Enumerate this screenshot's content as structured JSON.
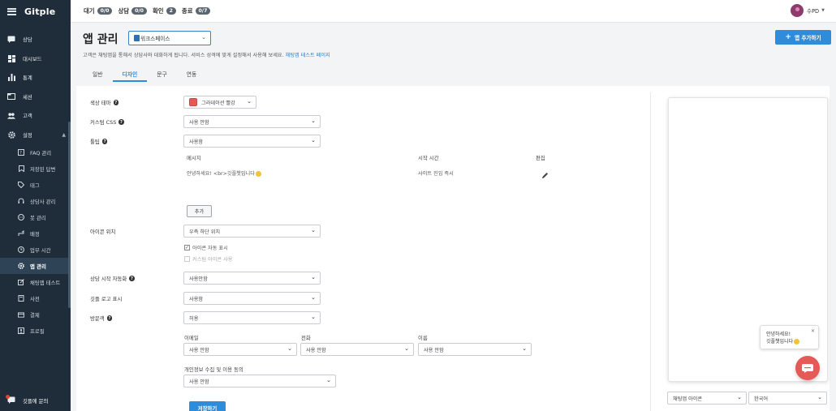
{
  "brand": "Gitple",
  "stats": [
    {
      "label": "대기",
      "badge": "0/0"
    },
    {
      "label": "상담",
      "badge": "0/0"
    },
    {
      "label": "확인",
      "badge": "2"
    },
    {
      "label": "종료",
      "badge": "0/7"
    }
  ],
  "user": {
    "name": "수PD"
  },
  "nav": {
    "consult": "상담",
    "dashboard": "대시보드",
    "stats": "통계",
    "session": "세션",
    "customer": "고객",
    "settings": "설정",
    "faq": "FAQ 관리",
    "saved": "저장된 답변",
    "tag": "태그",
    "agents": "상담사 관리",
    "bot": "봇 관리",
    "routing": "배정",
    "hours": "업무 시간",
    "app": "앱 관리",
    "chattest": "채팅앱 테스트",
    "dictionary": "사전",
    "billing": "결제",
    "profile": "프로필",
    "ask": "깃플에 문의"
  },
  "page": {
    "title": "앱 관리",
    "workspace": "워크스페이스",
    "add_app": "앱 추가하기",
    "description": "고객은 채팅앱을 통해서 상담사와 대화하게 됩니다. 서비스 성격에 맞게 설정해서 사용해 보세요.",
    "description_link": "채팅앱 테스트 페이지"
  },
  "tabs": [
    "일반",
    "디자인",
    "문구",
    "연동"
  ],
  "form": {
    "color_theme_label": "색상 테마",
    "color_theme_value": "그라데이션 빨강",
    "custom_css_label": "커스텀 CSS",
    "custom_css_value": "사용 안함",
    "tooltip_label": "툴팁",
    "tooltip_value": "사용함",
    "tooltip_table": {
      "headers": [
        "메시지",
        "시작 시간",
        "편집"
      ],
      "rows": [
        {
          "message": "안녕하세요! <br>깃플챗입니다",
          "start": "사이트 진입 즉시"
        }
      ]
    },
    "add_button": "추가",
    "icon_position_label": "아이콘 위치",
    "icon_position_value": "우측 하단 위치",
    "icon_auto_show": "아이콘 자동 표시",
    "custom_icon": "커스텀 아이콘 사용",
    "auto_start_label": "상담 시작 자동화",
    "auto_start_value": "사용안함",
    "gitple_logo_label": "깃플 로고 표시",
    "gitple_logo_value": "사용함",
    "visitor_label": "방문객",
    "visitor_value": "허용",
    "email_label": "이메일",
    "email_value": "사용 안함",
    "phone_label": "전화",
    "phone_value": "사용 안함",
    "name_label": "이름",
    "name_value": "사용 안함",
    "privacy_label": "개인정보 수집 및 이용 동의",
    "privacy_value": "사용 안함",
    "save": "저장하기"
  },
  "preview": {
    "bubble_line1": "안녕하세요!",
    "bubble_line2": "깃플챗입니다",
    "select_mode": "채팅앱 아이콘",
    "select_lang": "한국어"
  },
  "colors": {
    "accent": "#2f8cdb",
    "sidebar": "#1f2d3a",
    "theme": "#e35a57"
  }
}
